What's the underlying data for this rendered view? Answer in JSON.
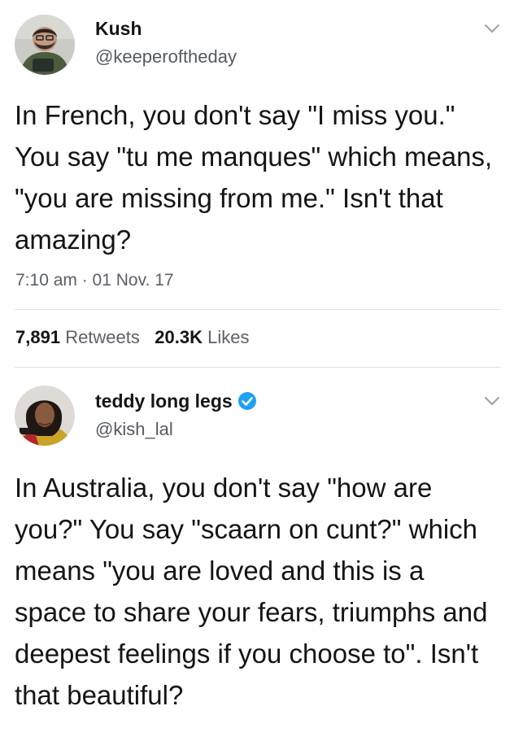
{
  "tweets": [
    {
      "user": {
        "name": "Kush",
        "handle": "@keeperoftheday",
        "avatar_icon": "avatar-man-beard-icon"
      },
      "text": "In French, you don't say \"I miss you.\" You say \"tu me manques\" which means, \"you are missing from me.\" Isn't that amazing?",
      "timestamp": "7:10 am · 01 Nov. 17",
      "retweets_count": "7,891",
      "retweets_label": "Retweets",
      "likes_count": "20.3K",
      "likes_label": "Likes"
    },
    {
      "user": {
        "name": "teddy long legs",
        "handle": "@kish_lal",
        "verified": true,
        "avatar_icon": "avatar-woman-icon"
      },
      "text": "In Australia, you don't say \"how are you?\" You say \"scaarn on cunt?\" which means \"you are loved and this is a space to share your fears, triumphs and deepest feelings if you choose to\". Isn't that beautiful?"
    }
  ],
  "colors": {
    "verified_blue": "#1da1f2",
    "secondary_text": "#5c6066",
    "divider": "#dfe3e6"
  }
}
